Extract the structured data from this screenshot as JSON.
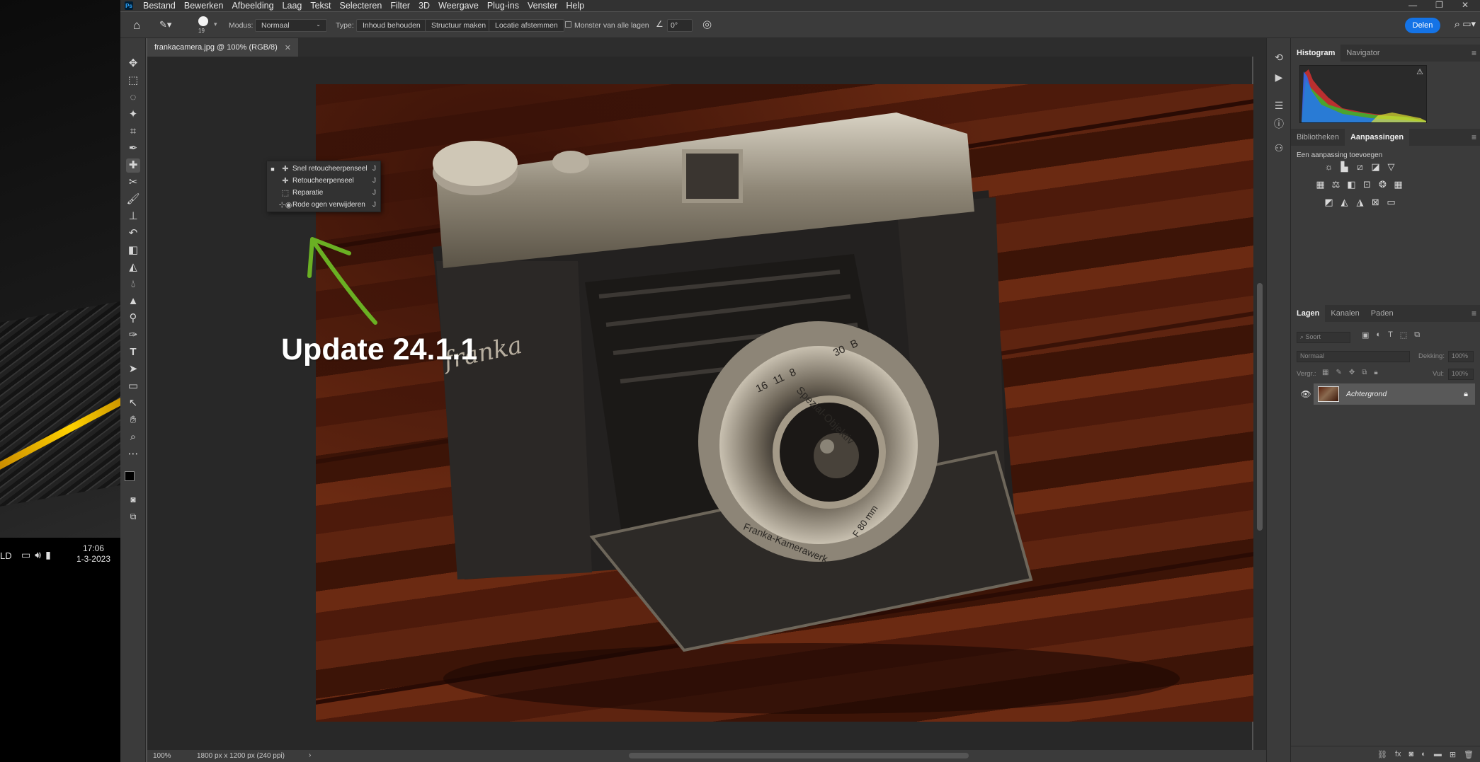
{
  "taskbar": {
    "ld": "LD",
    "time": "17:06",
    "date": "1-3-2023"
  },
  "menubar": {
    "logo": "Ps",
    "items": [
      "Bestand",
      "Bewerken",
      "Afbeelding",
      "Laag",
      "Tekst",
      "Selecteren",
      "Filter",
      "3D",
      "Weergave",
      "Plug-ins",
      "Venster",
      "Help"
    ]
  },
  "options": {
    "brush_size": "19",
    "mode_label": "Modus:",
    "mode_value": "Normaal",
    "type_label": "Type:",
    "type_buttons": [
      "Inhoud behouden",
      "Structuur maken",
      "Locatie afstemmen"
    ],
    "sample_all": "Monster van alle lagen",
    "angle": "0°",
    "share": "Delen"
  },
  "document": {
    "tab_title": "frankacamera.jpg @ 100% (RGB/8)",
    "zoom": "100%",
    "doc_info": "1800 px x 1200 px (240 ppi)"
  },
  "flyout": {
    "items": [
      {
        "label": "Snel retoucheerpenseel",
        "key": "J"
      },
      {
        "label": "Retoucheerpenseel",
        "key": "J"
      },
      {
        "label": "Reparatie",
        "key": "J"
      },
      {
        "label": "Rode ogen verwijderen",
        "key": "J"
      }
    ]
  },
  "annotation": {
    "text": "Update 24.1.1",
    "arrow_color": "#6ab023"
  },
  "photo": {
    "brand": "franka",
    "lens_ring": "Spezial-Objektiv",
    "lens_maker": "Franka-Kamerawerk",
    "aperture": "F 80 mm",
    "shutter_numbers": [
      "16",
      "11",
      "8",
      "30",
      "B"
    ]
  },
  "panels": {
    "top_tabs": [
      "Histogram",
      "Navigator"
    ],
    "mid_tabs": [
      "Bibliotheken",
      "Aanpassingen"
    ],
    "adjust_hint": "Een aanpassing toevoegen",
    "layer_tabs": [
      "Lagen",
      "Kanalen",
      "Paden"
    ],
    "search_placeholder": "Soort",
    "blend_mode": "Normaal",
    "opacity_label": "Dekking:",
    "opacity_value": "100%",
    "lock_label": "Vergr.:",
    "fill_label": "Vul:",
    "fill_value": "100%",
    "layer_name": "Achtergrond"
  },
  "colors": {
    "accent": "#1473e6",
    "panel_bg": "#3b3b3b",
    "canvas_bg": "#282828"
  }
}
